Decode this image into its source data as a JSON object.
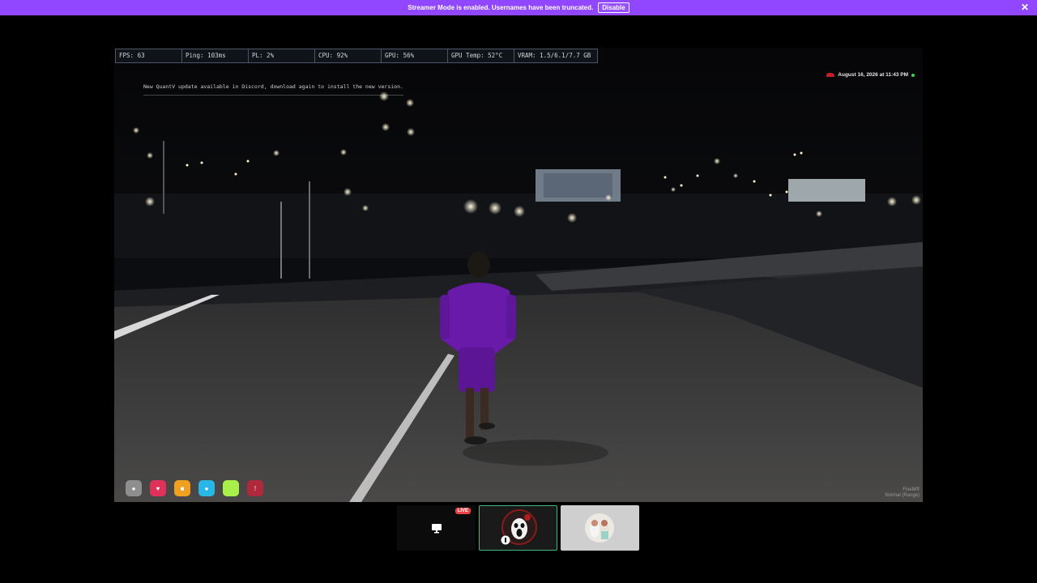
{
  "banner": {
    "message": "Streamer Mode is enabled. Usernames have been truncated.",
    "disable_label": "Disable",
    "close_icon": "close-icon",
    "color": "#9147ff"
  },
  "stream": {
    "perf": {
      "fps": "FPS: 63",
      "ping": "Ping: 103ms",
      "pl": "PL: 2%",
      "cpu": "CPU: 92%",
      "gpu": "GPU: 56%",
      "gpu_temp": "GPU Temp: 52°C",
      "vram": "VRAM: 1.5/6.1/7.7 GB"
    },
    "notice": "New QuantV update available in Discord, download again to install the new version.",
    "datetime": "August 16, 2026 at 11:43 PM",
    "hud_icons": [
      "microphone-icon",
      "heart-icon",
      "food-icon",
      "water-icon",
      "stamina-icon",
      "stress-icon"
    ],
    "watermark": "FiveM®",
    "status": "Normal (Range)"
  },
  "tiles": {
    "live_label": "LIVE",
    "screen_icon": "monitor-icon",
    "accent": "#43b581"
  }
}
